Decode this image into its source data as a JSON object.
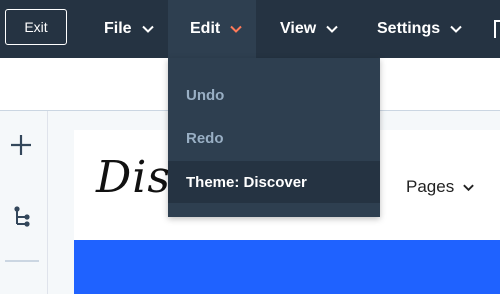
{
  "toolbar": {
    "exit_label": "Exit",
    "menus": [
      {
        "label": "File"
      },
      {
        "label": "Edit"
      },
      {
        "label": "View"
      },
      {
        "label": "Settings"
      }
    ],
    "active_menu": "Edit"
  },
  "edit_menu": {
    "items": [
      {
        "label": "Undo"
      },
      {
        "label": "Redo"
      },
      {
        "label": "Theme: Discover"
      }
    ]
  },
  "sidebar": {
    "icons": [
      "plus-icon",
      "tree-structure-icon"
    ]
  },
  "preview": {
    "logo_text": "Dis",
    "nav_label": "Pages"
  },
  "colors": {
    "topbar": "#253342",
    "menu_active": "#2e3f50",
    "accent_chevron": "#ff7a59",
    "banner": "#1f62ff",
    "disabled_text": "#99afc4"
  }
}
